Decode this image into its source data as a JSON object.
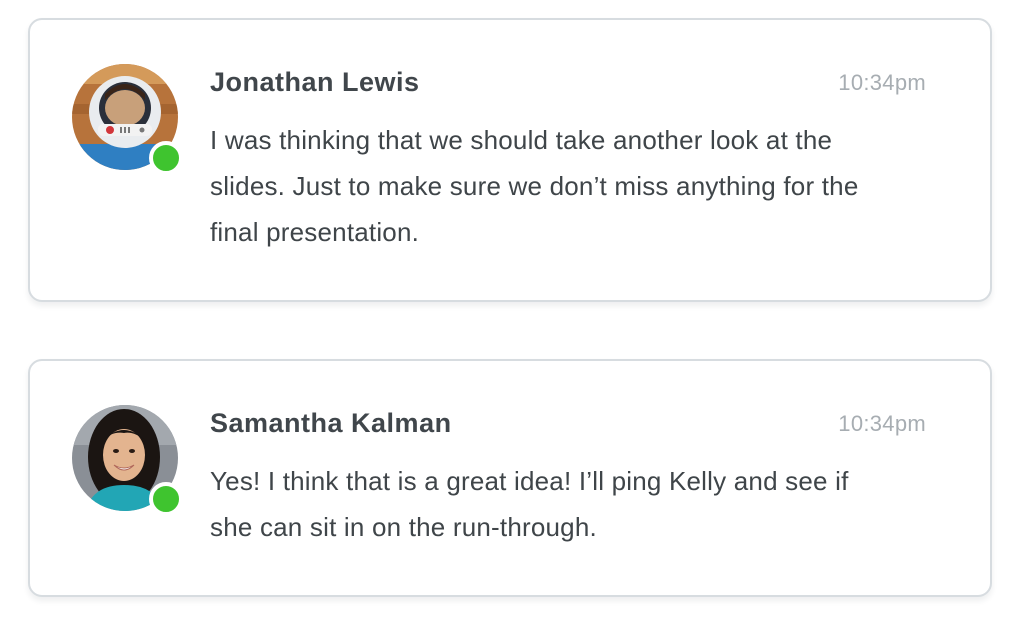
{
  "messages": [
    {
      "sender": "Jonathan Lewis",
      "time": "10:34pm",
      "text": "I was thinking that we should take another look at the slides. Just to make sure we don’t miss anything for the final presentation.",
      "status": "online",
      "avatar": "astronaut-helmet-photo"
    },
    {
      "sender": "Samantha Kalman",
      "time": "10:34pm",
      "text": "Yes! I think that is a great idea! I’ll ping Kelly and see if she can sit in on the run-through.",
      "status": "online",
      "avatar": "portrait-photo"
    }
  ],
  "colors": {
    "online": "#3fc42f",
    "card_border": "#d7dce0",
    "name_text": "#40464b",
    "time_text": "#a7adb2",
    "body_text": "#3f4549"
  }
}
